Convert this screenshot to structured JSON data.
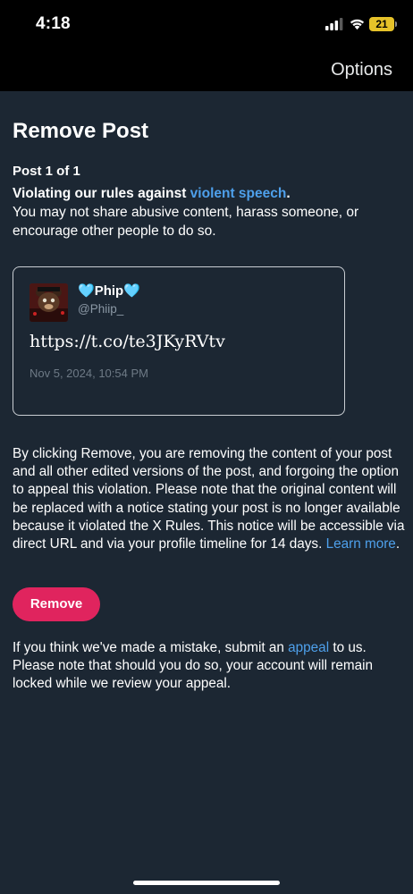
{
  "status_bar": {
    "time": "4:18",
    "battery_level": "21",
    "icons": [
      "signal-icon",
      "wifi-icon",
      "battery-icon"
    ]
  },
  "header": {
    "options_label": "Options"
  },
  "page": {
    "title": "Remove Post",
    "post_count": "Post 1 of 1",
    "violation_lead": "Violating our rules against ",
    "violation_link": "violent speech",
    "violation_end": ".",
    "violation_description": "You may not share abusive content, harass someone, or encourage other people to do so."
  },
  "post": {
    "heart_left": "🩵",
    "display_name": "Phip",
    "heart_right": "🩵",
    "handle": "@Phiip_",
    "text": "https://t.co/te3JKyRVtv",
    "timestamp": "Nov 5, 2024, 10:54 PM"
  },
  "explanation": {
    "text": "By clicking Remove, you are removing the content of your post and all other edited versions of the post, and forgoing the option to appeal this violation. Please note that the original content will be replaced with a notice stating your post is no longer available because it violated the X Rules. This notice will be accessible via direct URL and via your profile timeline for 14 days. ",
    "learn_more": "Learn more",
    "end": "."
  },
  "actions": {
    "remove_label": "Remove"
  },
  "appeal": {
    "lead": "If you think we've made a mistake, submit an ",
    "link": "appeal",
    "rest": " to us. Please note that should you do so, your account will remain locked while we review your appeal."
  },
  "colors": {
    "background": "#1c2733",
    "link": "#4ea0eb",
    "remove_button": "#e0245e"
  }
}
